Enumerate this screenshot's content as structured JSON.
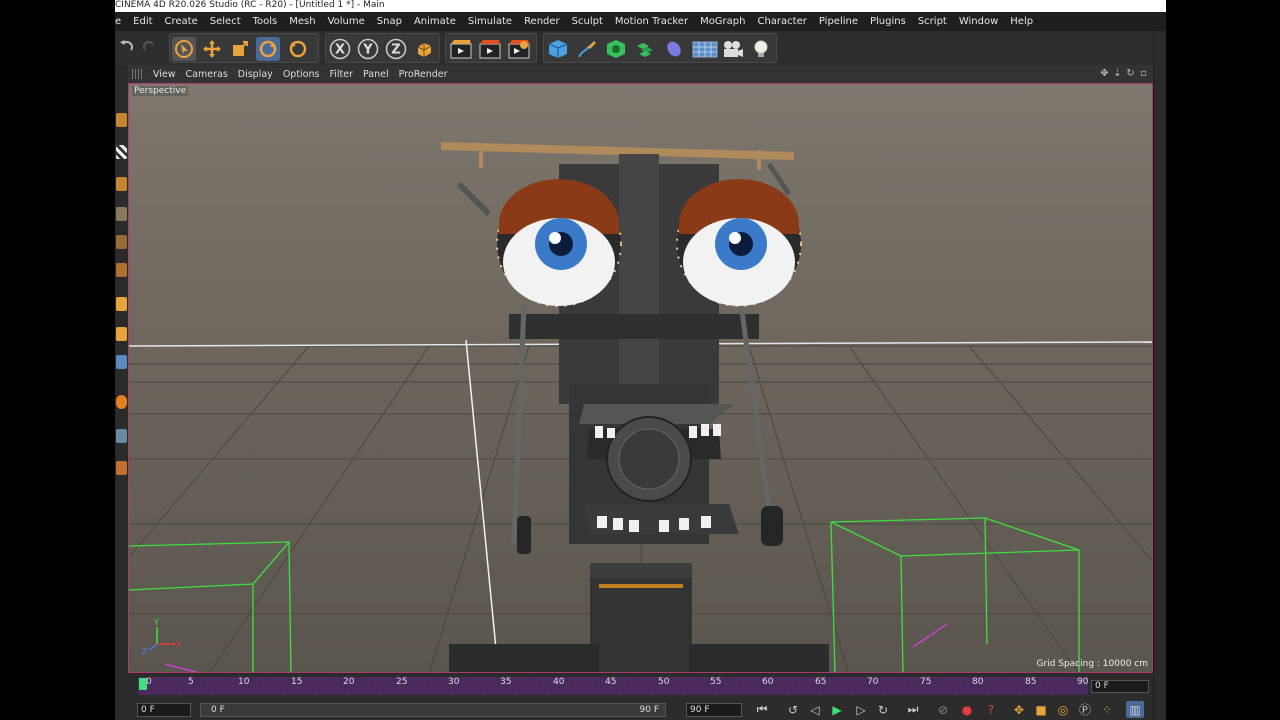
{
  "window": {
    "title": "CINEMA 4D R20.026 Studio (RC - R20) - [Untitled 1 *] - Main"
  },
  "menu": {
    "items": [
      "e",
      "Edit",
      "Create",
      "Select",
      "Tools",
      "Mesh",
      "Volume",
      "Snap",
      "Animate",
      "Simulate",
      "Render",
      "Sculpt",
      "Motion Tracker",
      "MoGraph",
      "Character",
      "Pipeline",
      "Plugins",
      "Script",
      "Window",
      "Help"
    ]
  },
  "toolbar": {
    "axis_x": "X",
    "axis_y": "Y",
    "axis_z": "Z",
    "icons": [
      "undo-icon",
      "redo-icon",
      "select-arrow-icon",
      "move-icon",
      "scale-icon",
      "rotate-icon",
      "rotate-alt-icon",
      "axis-x-icon",
      "axis-y-icon",
      "axis-z-icon",
      "coordinate-system-icon",
      "render-view-icon",
      "render-picture-queue-icon",
      "render-settings-icon",
      "cube-icon",
      "pen-icon",
      "subdivision-icon",
      "array-icon",
      "deformer-icon",
      "floor-icon",
      "camera-icon",
      "light-icon"
    ],
    "accent": "#e8a33c"
  },
  "viewport": {
    "menu": [
      "View",
      "Cameras",
      "Display",
      "Options",
      "Filter",
      "Panel",
      "ProRender"
    ],
    "label": "Perspective",
    "grid_spacing": "Grid Spacing : 10000 cm",
    "border_color": "#b03a6a",
    "axis_labels": {
      "y": "Y",
      "x": "X",
      "z": "Z"
    }
  },
  "timeline": {
    "ticks": [
      "0",
      "5",
      "10",
      "15",
      "20",
      "25",
      "30",
      "35",
      "40",
      "45",
      "50",
      "55",
      "60",
      "65",
      "70",
      "75",
      "80",
      "85",
      "90"
    ],
    "current_frame": "0 F",
    "track_color": "#4a2a5c"
  },
  "bottombar": {
    "start_field": "0 F",
    "range_start": "0 F",
    "range_end": "90 F",
    "end_field": "90 F"
  }
}
